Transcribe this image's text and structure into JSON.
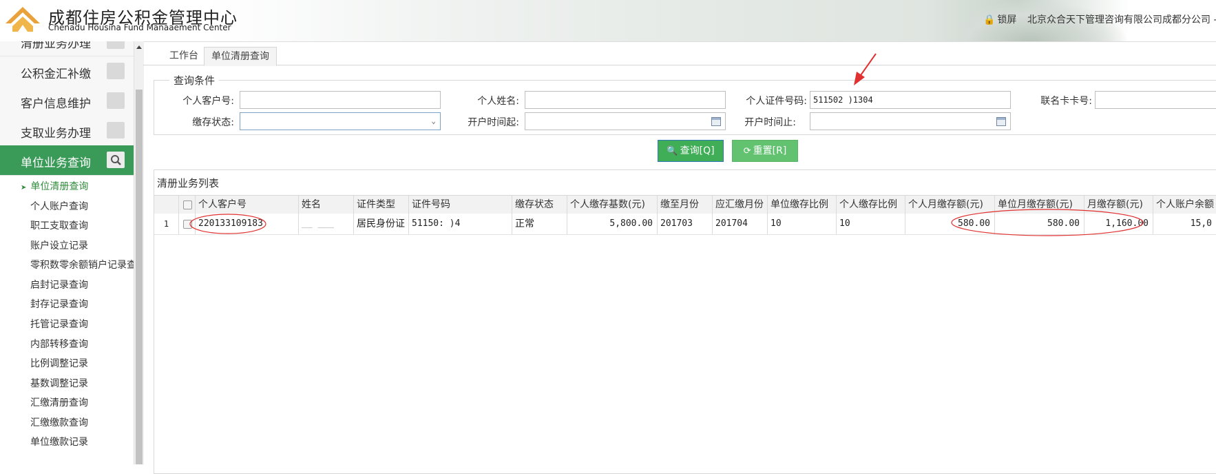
{
  "header": {
    "title_cn": "成都住房公积金管理中心",
    "title_en": "Chenadu  Housina Fund Manaaement Center",
    "lock_label": "锁屏",
    "company": "北京众合天下管理咨询有限公司成都分公司 -"
  },
  "sidebar": {
    "menu": [
      {
        "label": "清册业务办理"
      },
      {
        "label": "公积金汇补缴"
      },
      {
        "label": "客户信息维护"
      },
      {
        "label": "支取业务办理"
      },
      {
        "label": "单位业务查询"
      }
    ],
    "sub_items": [
      {
        "label": "单位清册查询"
      },
      {
        "label": "个人账户查询"
      },
      {
        "label": "职工支取查询"
      },
      {
        "label": "账户设立记录"
      },
      {
        "label": "零积数零余额销户记录查"
      },
      {
        "label": "启封记录查询"
      },
      {
        "label": "封存记录查询"
      },
      {
        "label": "托管记录查询"
      },
      {
        "label": "内部转移查询"
      },
      {
        "label": "比例调整记录"
      },
      {
        "label": "基数调整记录"
      },
      {
        "label": "汇缴清册查询"
      },
      {
        "label": "汇缴缴款查询"
      },
      {
        "label": "单位缴款记录"
      }
    ]
  },
  "tabs": [
    {
      "label": "工作台"
    },
    {
      "label": "单位清册查询"
    }
  ],
  "query": {
    "title": "查询条件",
    "customer_no": {
      "label": "个人客户号:",
      "value": ""
    },
    "name": {
      "label": "个人姓名:",
      "value": ""
    },
    "id_no": {
      "label": "个人证件号码:",
      "value": "511502              )1304"
    },
    "card_no": {
      "label": "联名卡卡号:",
      "value": ""
    },
    "status": {
      "label": "缴存状态:",
      "value": ""
    },
    "open_from": {
      "label": "开户时间起:",
      "value": ""
    },
    "open_to": {
      "label": "开户时间止:",
      "value": ""
    },
    "query_button": "查询[Q]",
    "reset_button": "重置[R]"
  },
  "list": {
    "title": "清册业务列表",
    "columns": [
      "个人客户号",
      "姓名",
      "证件类型",
      "证件号码",
      "缴存状态",
      "个人缴存基数(元)",
      "缴至月份",
      "应汇缴月份",
      "单位缴存比例",
      "个人缴存比例",
      "个人月缴存额(元)",
      "单位月缴存额(元)",
      "月缴存额(元)",
      "个人账户余额"
    ],
    "rows": [
      {
        "index": "1",
        "customer_no": "220133109183",
        "name": "__ ___",
        "id_type": "居民身份证",
        "id_no": "51150:              )4",
        "status": "正常",
        "base": "5,800.00",
        "paid_to": "201703",
        "due_month": "201704",
        "unit_ratio": "10",
        "person_ratio": "10",
        "person_amount": "580.00",
        "unit_amount": "580.00",
        "month_amount": "1,160.00",
        "balance": "15,0"
      }
    ]
  },
  "colors": {
    "accent_green": "#3a9a57",
    "annotation_red": "#e03030"
  }
}
